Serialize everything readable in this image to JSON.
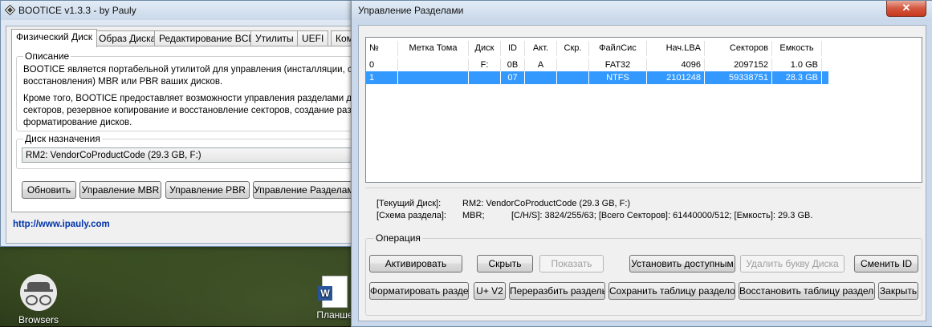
{
  "desktop": {
    "browsers_label": "Browsers",
    "word_label": "Планше"
  },
  "bootice": {
    "title": "BOOTICE v1.3.3 - by Pauly",
    "tabs": [
      "Физический Диск",
      "Образ Диска",
      "Редактирование BCD",
      "Утилиты",
      "UEFI",
      "Кома"
    ],
    "description_title": "Описание",
    "description_lines": [
      "BOOTICE является портабельной утилитой для управления (инсталляции, сохр",
      "восстановления) MBR или PBR ваших дисков.",
      "Кроме того, BOOTICE предоставляет возможности управления разделами диск",
      "секторов,  резервное копирование и восстановление секторов, создание разде",
      "форматирование дисков."
    ],
    "target_title": "Диск назначения",
    "target_value": "RM2: VendorCoProductCode (29.3 GB, F:)",
    "buttons": {
      "refresh": "Обновить",
      "mbr": "Управление MBR",
      "pbr": "Управление PBR",
      "parts": "Управление Разделами"
    },
    "link": "http://www.ipauly.com"
  },
  "partitions": {
    "title": "Управление Разделами",
    "close_glyph": "✕",
    "columns": [
      "№",
      "Метка Тома",
      "Диск",
      "ID",
      "Акт.",
      "Скр.",
      "ФайлСис",
      "Нач.LBA",
      "Секторов",
      "Емкость"
    ],
    "rows": [
      {
        "num": "0",
        "label": "",
        "disk": "F:",
        "id": "0B",
        "active": "A",
        "hidden": "",
        "fs": "FAT32",
        "start": "4096",
        "sectors": "2097152",
        "size": "1.0 GB"
      },
      {
        "num": "1",
        "label": "",
        "disk": "",
        "id": "07",
        "active": "",
        "hidden": "",
        "fs": "NTFS",
        "start": "2101248",
        "sectors": "59338751",
        "size": "28.3 GB"
      }
    ],
    "selected_row": 1,
    "info": {
      "disk_label": "[Текущий Диск]:",
      "disk_value": "RM2: VendorCoProductCode (29.3 GB, F:)",
      "scheme_label": "[Схема раздела]:",
      "scheme_value": "MBR;",
      "chs": "[C/H/S]: 3824/255/63; [Всего Секторов]: 61440000/512; [Емкость]: 29.3 GB."
    },
    "operation_title": "Операция",
    "buttons": {
      "activate": "Активировать",
      "hide": "Скрыть",
      "show": "Показать",
      "set_accessible": "Установить доступным",
      "remove_letter": "Удалить букву Диска",
      "change_id": "Сменить ID",
      "format": "Форматировать раздел",
      "uv2": "U+ V2",
      "repartition": "Переразбить разделы",
      "save_table": "Сохранить таблицу разделов",
      "restore_table": "Восстановить таблицу разделов",
      "close": "Закрыть"
    }
  }
}
